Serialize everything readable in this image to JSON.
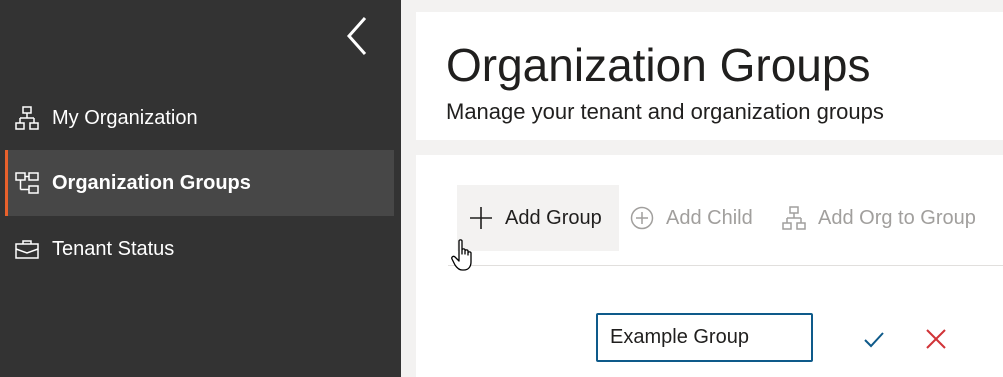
{
  "sidebar": {
    "collapse_icon": "chevron-left-icon",
    "items": [
      {
        "label": "My Organization",
        "icon": "org-chart-icon",
        "active": false
      },
      {
        "label": "Organization Groups",
        "icon": "org-groups-icon",
        "active": true
      },
      {
        "label": "Tenant Status",
        "icon": "briefcase-icon",
        "active": false
      }
    ]
  },
  "header": {
    "title": "Organization Groups",
    "subtitle": "Manage your tenant and organization groups"
  },
  "toolbar": {
    "add_group_label": "Add Group",
    "add_child_label": "Add Child",
    "add_org_label": "Add Org to Group"
  },
  "editor": {
    "group_name_value": "Example Group"
  },
  "colors": {
    "sidebar_bg": "#333333",
    "active_item_bg": "#474747",
    "accent": "#e8612c",
    "input_border": "#0e5a8a",
    "confirm": "#0e5a8a",
    "cancel": "#d13438",
    "disabled_text": "#a19f9d"
  }
}
